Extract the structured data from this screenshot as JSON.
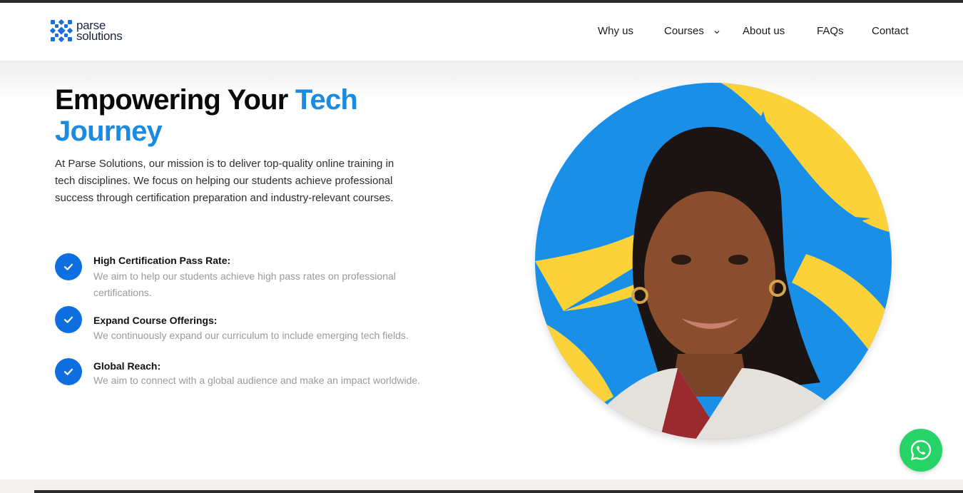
{
  "brand": {
    "line1": "parse",
    "line2": "solutions",
    "logo_icon": "parse-logo-icon"
  },
  "nav": {
    "items": [
      {
        "label": "Why us"
      },
      {
        "label": "Courses"
      },
      {
        "label": "About us"
      },
      {
        "label": "FAQs"
      },
      {
        "label": "Contact"
      }
    ]
  },
  "hero": {
    "title_part1": "Empowering Your ",
    "title_part2": "Tech",
    "title_part3": "Journey",
    "intro": "At Parse Solutions, our mission is to deliver top-quality online training in tech disciplines. We focus on helping our students achieve professional success through certification preparation and industry-relevant courses."
  },
  "features": [
    {
      "title": "High Certification Pass Rate:",
      "desc": "We aim to help our students achieve high pass rates on professional certifications."
    },
    {
      "title": "Expand Course Offerings:",
      "desc": "We continuously expand our curriculum to include emerging tech fields."
    },
    {
      "title": "Global Reach:",
      "desc": "We aim to connect with a global audience and make an impact worldwide."
    }
  ],
  "colors": {
    "accent": "#1a8be0",
    "check": "#0d6fe0",
    "portrait_blue": "#1a8fe8",
    "portrait_yellow": "#fbd23a",
    "whatsapp": "#25d366"
  }
}
